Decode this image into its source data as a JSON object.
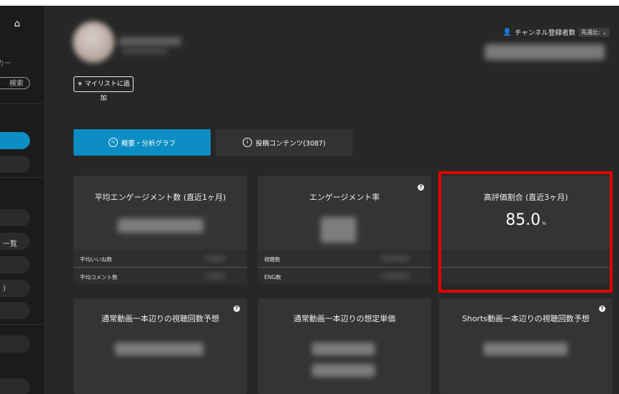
{
  "sidebar": {
    "home_icon": "home-icon",
    "search_hint": "カー",
    "search_button": "検索",
    "items": [
      {
        "label": ""
      },
      {
        "label": "一覧"
      },
      {
        "label": ")"
      }
    ]
  },
  "channel": {
    "mylist_button": "マイリストに追加",
    "subs_label": "チャンネル登録者数",
    "period_select": "先週比: ⌄"
  },
  "tabs": [
    {
      "label": "概要・分析グラフ",
      "active": true
    },
    {
      "label": "投稿コンテンツ(3087)",
      "active": false
    }
  ],
  "cards": [
    {
      "title": "平均エンゲージメント数 (直近1ヶ月)",
      "rows": [
        {
          "label": "平均いいね数"
        },
        {
          "label": "平均コメント数"
        }
      ]
    },
    {
      "title": "エンゲージメント率",
      "rows": [
        {
          "label": "視聴数"
        },
        {
          "label": "ENG数"
        }
      ]
    },
    {
      "title": "高評価割合 (直近3ヶ月)",
      "value": "85.0",
      "unit": "%"
    },
    {
      "title": "通常動画一本辺りの視聴回数予想"
    },
    {
      "title": "通常動画一本辺りの想定単価"
    },
    {
      "title": "Shorts動画一本辺りの視聴回数予想"
    }
  ],
  "colors": {
    "accent": "#0c8ec4",
    "highlight": "#e60000",
    "background": "#272727",
    "card": "#343434"
  }
}
